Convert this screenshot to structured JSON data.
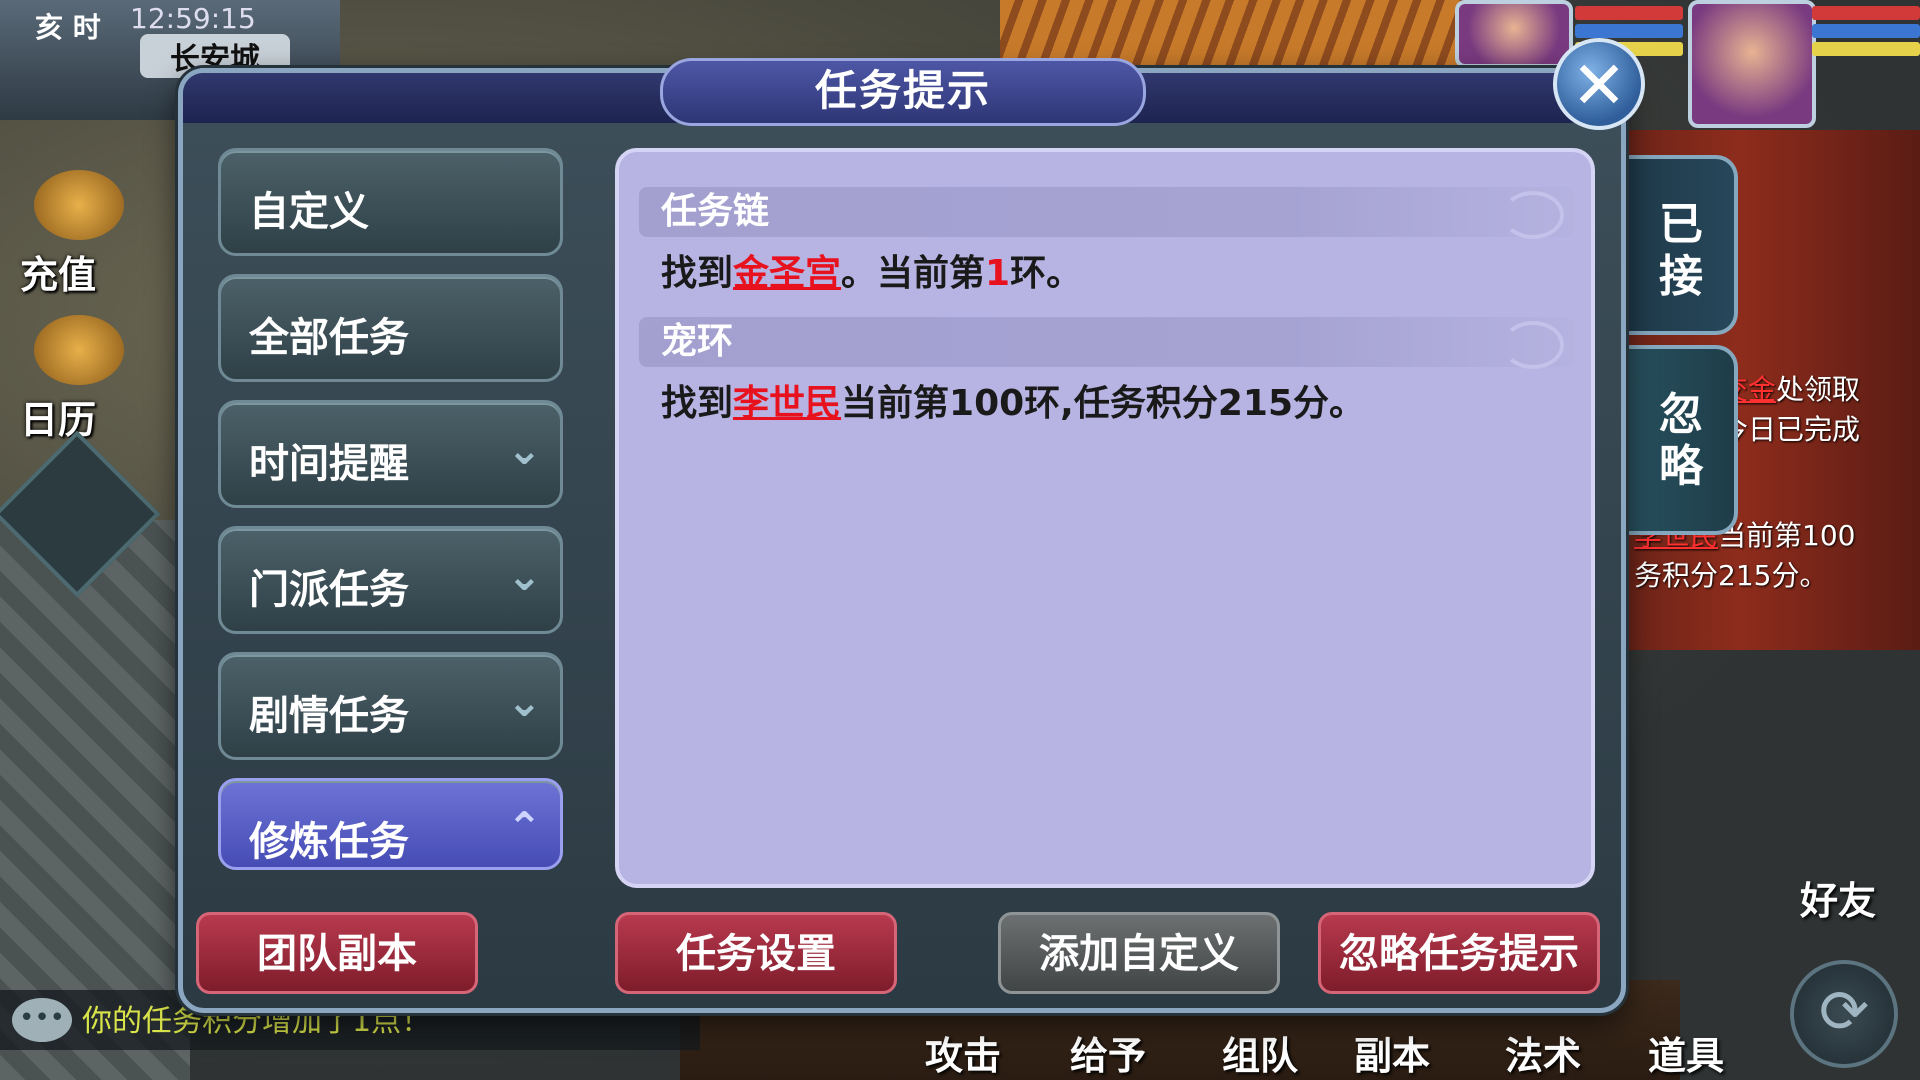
{
  "hud": {
    "period": "亥 时",
    "clock": "12:59:15",
    "city": "长安城",
    "recharge_label": "充值",
    "calendar_label": "日历"
  },
  "dialog": {
    "title": "任务提示",
    "close_icon": "close-icon",
    "categories": [
      {
        "label": "自定义",
        "arrow": "",
        "active": false
      },
      {
        "label": "全部任务",
        "arrow": "",
        "active": false
      },
      {
        "label": "时间提醒",
        "arrow": "⌄",
        "active": false
      },
      {
        "label": "门派任务",
        "arrow": "⌄",
        "active": false
      },
      {
        "label": "剧情任务",
        "arrow": "⌄",
        "active": false
      },
      {
        "label": "修炼任务",
        "arrow": "⌃",
        "active": true
      }
    ],
    "tasks": [
      {
        "name": "任务链",
        "prefix": "找到",
        "place": "金圣宫",
        "mid": "。当前第",
        "num": "1",
        "suffix": "环。"
      },
      {
        "name": "宠环",
        "prefix": "找到",
        "place": "李世民",
        "mid": "当前第100环,任务积分215分。",
        "num": "",
        "suffix": ""
      }
    ],
    "buttons": {
      "team_dungeon": "团队副本",
      "task_settings": "任务设置",
      "add_custom": "添加自定义",
      "ignore_tips": "忽略任务提示"
    }
  },
  "side_tabs": {
    "accepted": "已\n接",
    "ignore": "忽\n略"
  },
  "task_preview": {
    "line1_red": "交金",
    "line1_rest": "处领取",
    "line2": "今日已完成",
    "line3_red": "李世民",
    "line3_rest": "当前第100",
    "line4": "务积分215分。"
  },
  "chat": {
    "icon": "chat-bubble-icon",
    "text": "你的任务积分增加了1点！"
  },
  "bottom_menu": {
    "attack": "攻击",
    "give": "给予",
    "team": "组队",
    "dungeon": "副本",
    "magic": "法术",
    "items": "道具"
  },
  "right_hud": {
    "friends": "好友"
  },
  "colors": {
    "highlight_red": "#e8121e",
    "panel_lavender": "#b7b4e3",
    "active_tab": "#5a60c4",
    "button_red": "#9c2a3c"
  }
}
